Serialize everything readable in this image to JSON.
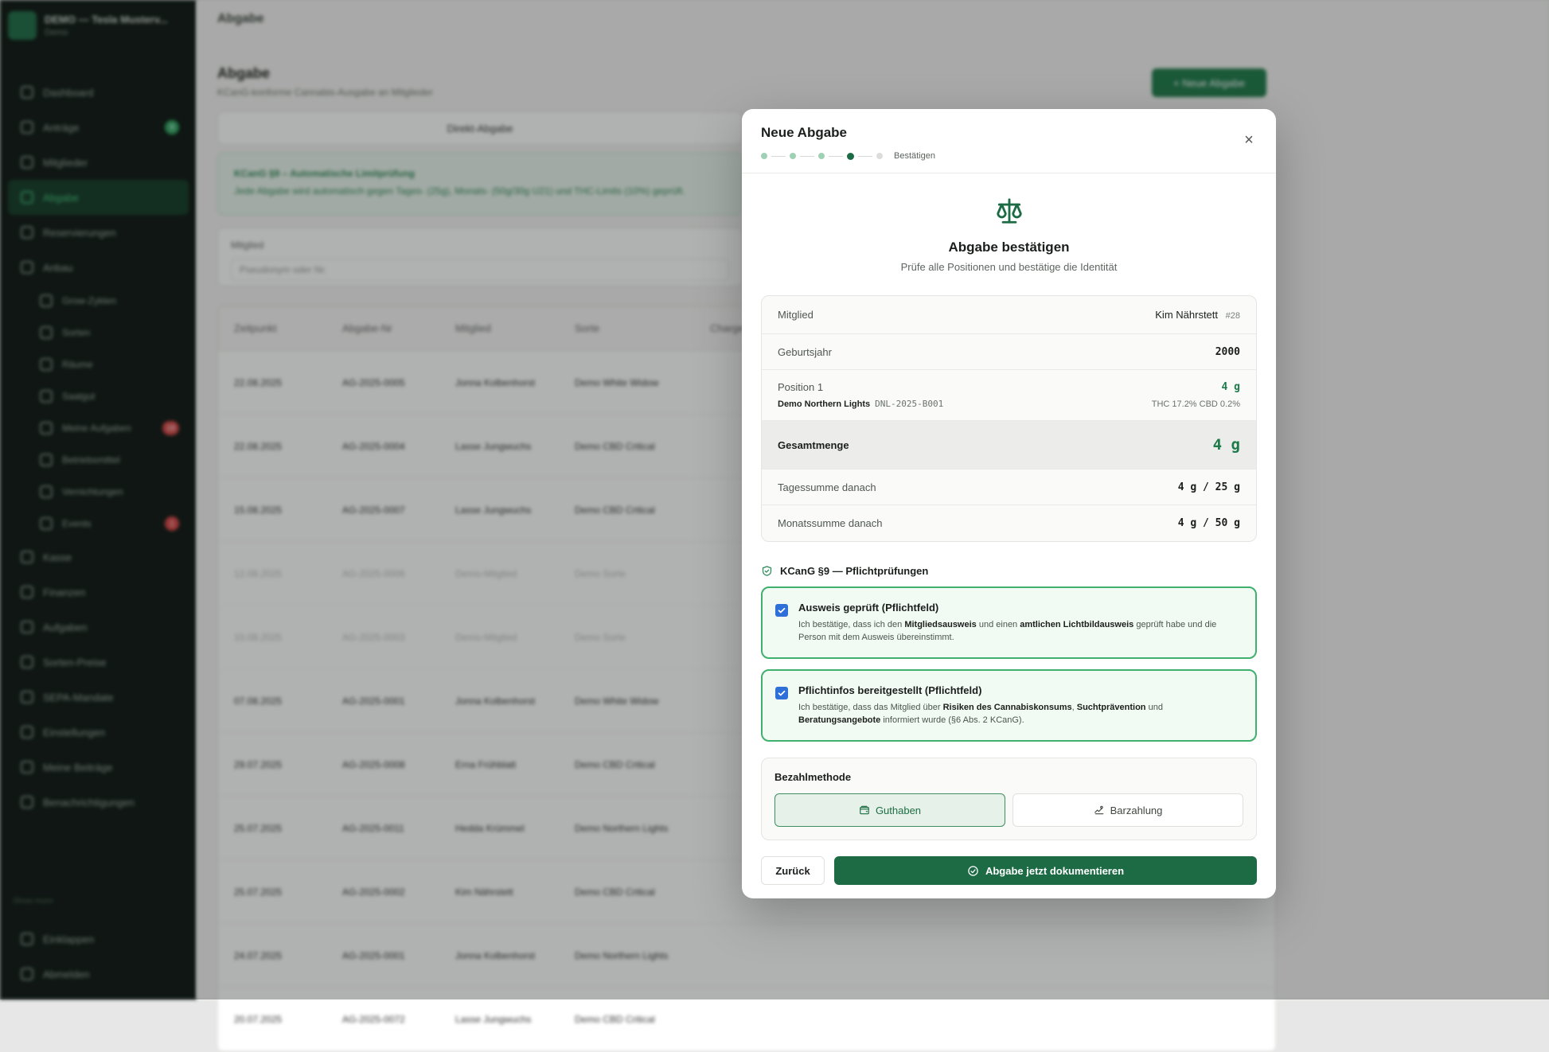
{
  "sidebar": {
    "brand_title": "DEMO — Tesla Musterv...",
    "brand_sub": "Demo",
    "items": [
      {
        "label": "Dashboard"
      },
      {
        "label": "Anträge",
        "badge": "9"
      },
      {
        "label": "Mitglieder"
      },
      {
        "label": "Abgabe",
        "active": true
      },
      {
        "label": "Reservierungen"
      },
      {
        "label": "Anbau"
      },
      {
        "label": "Grow-Zyklen",
        "sub": true
      },
      {
        "label": "Sorten",
        "sub": true
      },
      {
        "label": "Räume",
        "sub": true
      },
      {
        "label": "Saatgut",
        "sub": true
      },
      {
        "label": "Meine Aufgaben",
        "sub": true,
        "badge": "18"
      },
      {
        "label": "Betriebsmittel",
        "sub": true
      },
      {
        "label": "Vernichtungen",
        "sub": true
      },
      {
        "label": "Events",
        "sub": true,
        "badge": "1"
      },
      {
        "label": "Kasse"
      },
      {
        "label": "Finanzen"
      },
      {
        "label": "Aufgaben"
      },
      {
        "label": "Sorten-Preise"
      },
      {
        "label": "SEPA-Mandate"
      },
      {
        "label": "Einstellungen"
      },
      {
        "label": "Meine Beiträge"
      },
      {
        "label": "Benachrichtigungen"
      }
    ],
    "footer_label": "Show more",
    "footer_items": [
      {
        "label": "Einklappen"
      },
      {
        "label": "Abmelden"
      }
    ]
  },
  "main": {
    "topbar_title": "Abgabe",
    "page_title": "Abgabe",
    "page_sub": "KCanG-konforme Cannabis-Ausgabe an Mitglieder",
    "new_button": "+ Neue Abgabe",
    "quick_button": "Direkt-Abgabe",
    "info_title": "KCanG §9 – Automatische Limitprüfung",
    "info_text": "Jede Abgabe wird automatisch gegen Tages- (25g), Monats- (50g/30g U21) und THC-Limits (10%) geprüft.",
    "filter_label": "Mitglied",
    "filter_placeholder": "Pseudonym oder Nr.",
    "table_headers": [
      "Zeitpunkt",
      "Abgabe-Nr",
      "Mitglied",
      "Sorte",
      "Charge"
    ],
    "rows": [
      {
        "date": "22.08.2025",
        "no": "AG-2025-0005",
        "member": "Jonna Kolbenhorst",
        "strain": "Demo White Widow",
        "faded": false
      },
      {
        "date": "22.08.2025",
        "no": "AG-2025-0004",
        "member": "Lasse Jungwuchs",
        "strain": "Demo CBD Critical",
        "faded": false
      },
      {
        "date": "15.08.2025",
        "no": "AG-2025-0007",
        "member": "Lasse Jungwuchs",
        "strain": "Demo CBD Critical",
        "faded": false
      },
      {
        "date": "12.08.2025",
        "no": "AG-2025-0006",
        "member": "Demo-Mitglied",
        "strain": "Demo Sorte",
        "faded": true
      },
      {
        "date": "10.08.2025",
        "no": "AG-2025-0003",
        "member": "Demo-Mitglied",
        "strain": "Demo Sorte",
        "faded": true
      },
      {
        "date": "07.08.2025",
        "no": "AG-2025-0001",
        "member": "Jonna Kolbenhorst",
        "strain": "Demo White Widow",
        "faded": false
      },
      {
        "date": "29.07.2025",
        "no": "AG-2025-0008",
        "member": "Erna Frühblatt",
        "strain": "Demo CBD Critical",
        "faded": false
      },
      {
        "date": "25.07.2025",
        "no": "AG-2025-0011",
        "member": "Hedda Krümmel",
        "strain": "Demo Northern Lights",
        "faded": false
      },
      {
        "date": "25.07.2025",
        "no": "AG-2025-0002",
        "member": "Kim Nährstett",
        "strain": "Demo CBD Critical",
        "faded": false
      },
      {
        "date": "24.07.2025",
        "no": "AG-2025-0001",
        "member": "Jonna Kolbenhorst",
        "strain": "Demo Northern Lights",
        "faded": false
      },
      {
        "date": "20.07.2025",
        "no": "AG-2025-0072",
        "member": "Lasse Jungwuchs",
        "strain": "Demo CBD Critical",
        "faded": false
      }
    ]
  },
  "modal": {
    "title": "Neue Abgabe",
    "step_label": "Bestätigen",
    "close_symbol": "×",
    "hero_title": "Abgabe bestätigen",
    "hero_sub": "Prüfe alle Positionen und bestätige die Identität",
    "member_label": "Mitglied",
    "member_name": "Kim Nährstett",
    "member_no": "#28",
    "birth_label": "Geburtsjahr",
    "birth_value": "2000",
    "position_label": "Position 1",
    "position_strain": "Demo Northern Lights",
    "position_batch": "DNL-2025-B001",
    "position_amount": "4 g",
    "position_thc": "THC 17.2% CBD 0.2%",
    "total_label": "Gesamtmenge",
    "total_value": "4 g",
    "day_label": "Tagessumme danach",
    "day_value": "4 g / 25 g",
    "month_label": "Monatssumme danach",
    "month_value": "4 g / 50 g",
    "kcang_title": "KCanG §9 — Pflichtprüfungen",
    "check1": {
      "title": "Ausweis geprüft (Pflichtfeld)",
      "t1": "Ich bestätige, dass ich den ",
      "b1": "Mitgliedsausweis",
      "t2": " und einen ",
      "b2": "amtlichen Lichtbildausweis",
      "t3": " geprüft habe und die Person mit dem Ausweis übereinstimmt."
    },
    "check2": {
      "title": "Pflichtinfos bereitgestellt (Pflichtfeld)",
      "t1": "Ich bestätige, dass das Mitglied über ",
      "b1": "Risiken des Cannabiskonsums",
      "t2": ", ",
      "b2": "Suchtprävention",
      "t3": " und ",
      "b3": "Beratungsangebote",
      "t4": " informiert wurde (§6 Abs. 2 KCanG)."
    },
    "pay_title": "Bezahlmethode",
    "pay_credit": "Guthaben",
    "pay_cash": "Barzahlung",
    "back_button": "Zurück",
    "submit_button": "Abgabe jetzt dokumentieren",
    "colors": {
      "accent": "#1d6b45",
      "accent_light": "#3fb06e",
      "checkbox": "#2f6fd8"
    },
    "icons": [
      "scale-icon",
      "close-icon",
      "shield-check-icon",
      "checkbox-checked-icon",
      "wallet-icon",
      "cash-icon",
      "check-circle-icon"
    ]
  }
}
